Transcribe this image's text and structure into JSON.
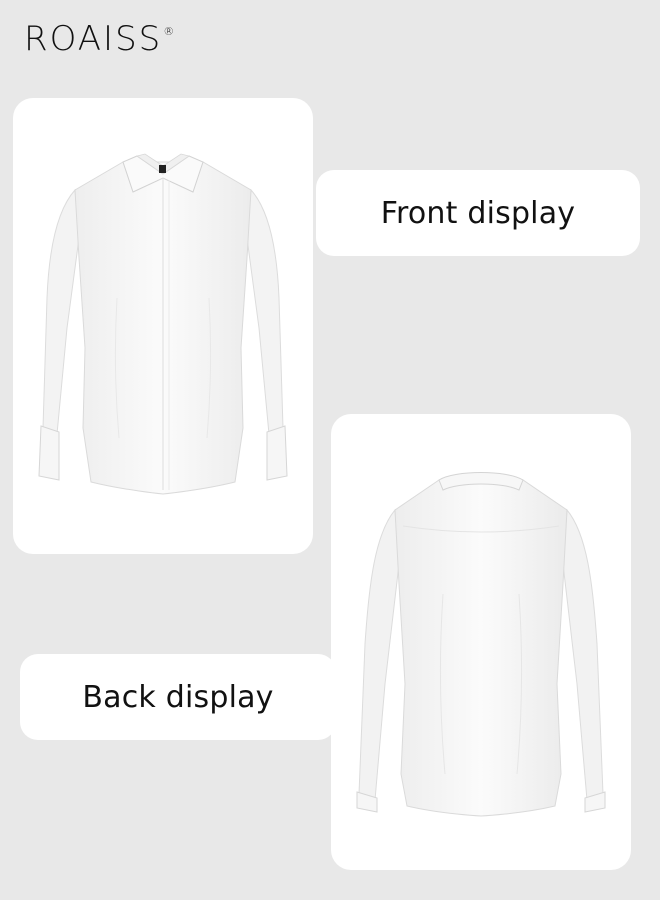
{
  "brand": {
    "name": "ROAISS",
    "registered_mark": "®"
  },
  "labels": {
    "front": "Front display",
    "back": "Back display"
  },
  "products": [
    {
      "view": "front",
      "description": "white long-sleeve button-up shirt, front view"
    },
    {
      "view": "back",
      "description": "white long-sleeve button-up shirt, back view"
    }
  ],
  "colors": {
    "background": "#e8e8e8",
    "card": "#ffffff",
    "text": "#111111"
  }
}
